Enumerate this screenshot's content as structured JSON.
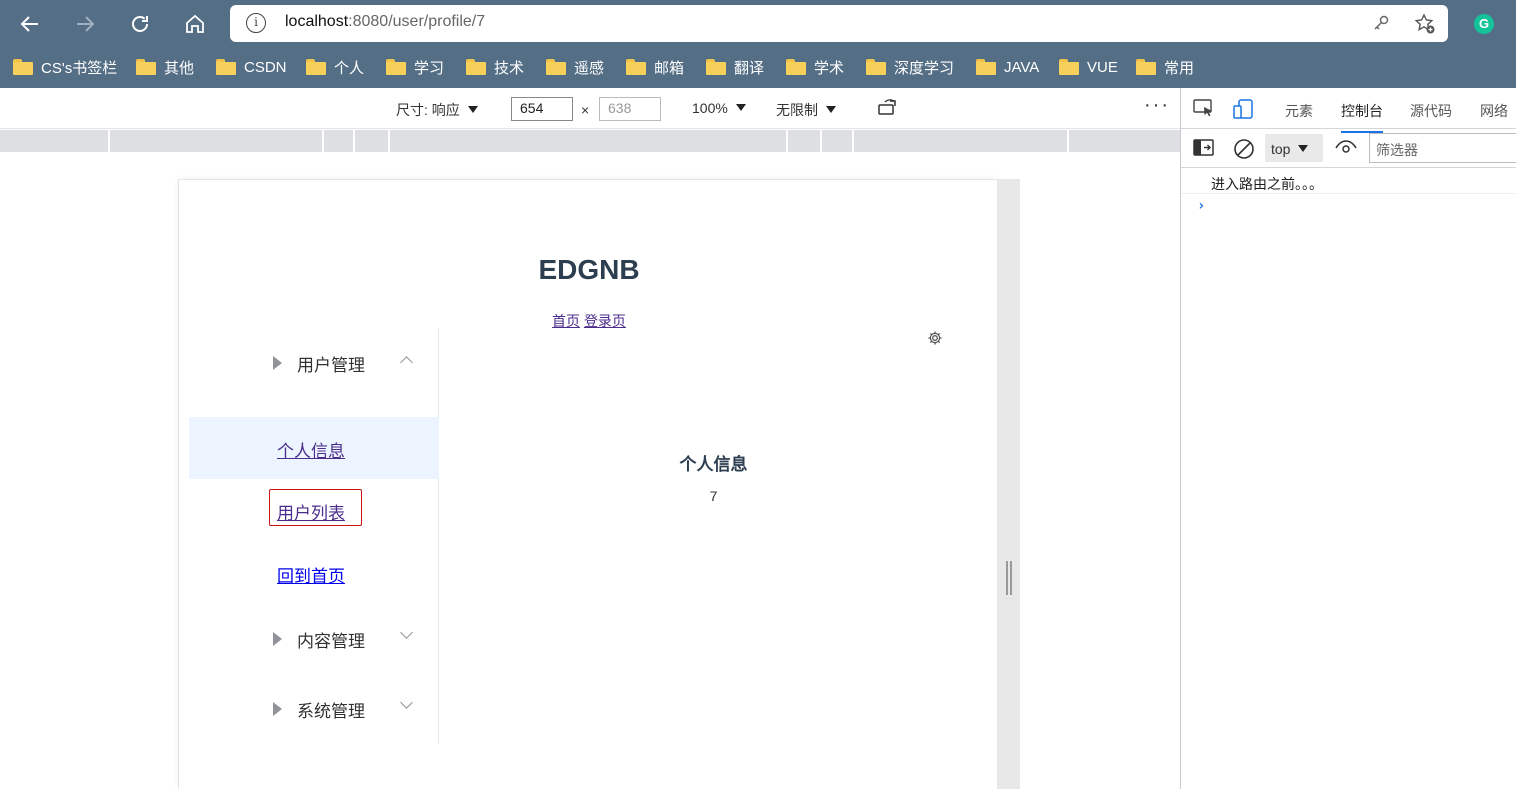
{
  "browser": {
    "url_host": "localhost",
    "url_path": ":8080/user/profile/7",
    "info_glyph": "i",
    "extension_glyph": "G",
    "bookmarks": [
      "CS's书签栏",
      "其他",
      "CSDN",
      "个人",
      "学习",
      "技术",
      "遥感",
      "邮箱",
      "翻译",
      "学术",
      "深度学习",
      "JAVA",
      "VUE",
      "常用"
    ]
  },
  "device_toolbar": {
    "size_label": "尺寸: 响应",
    "width_value": "654",
    "height_placeholder": "638",
    "times": "×",
    "zoom": "100%",
    "throttle": "无限制",
    "more": "⋮"
  },
  "page": {
    "title": "EDGNB",
    "link_home": "首页",
    "link_login": "登录页",
    "menu": {
      "user_mgmt": "用户管理",
      "profile": "个人信息",
      "user_list": "用户列表",
      "back_home": "回到首页",
      "content_mgmt": "内容管理",
      "system_mgmt": "系统管理"
    },
    "content_title": "个人信息",
    "content_id": "7"
  },
  "devtools": {
    "tabs": [
      "元素",
      "控制台",
      "源代码",
      "网络"
    ],
    "active_tab": "控制台",
    "context": "top",
    "filter_placeholder": "筛选器",
    "log": "进入路由之前。。。",
    "prompt": "›"
  }
}
